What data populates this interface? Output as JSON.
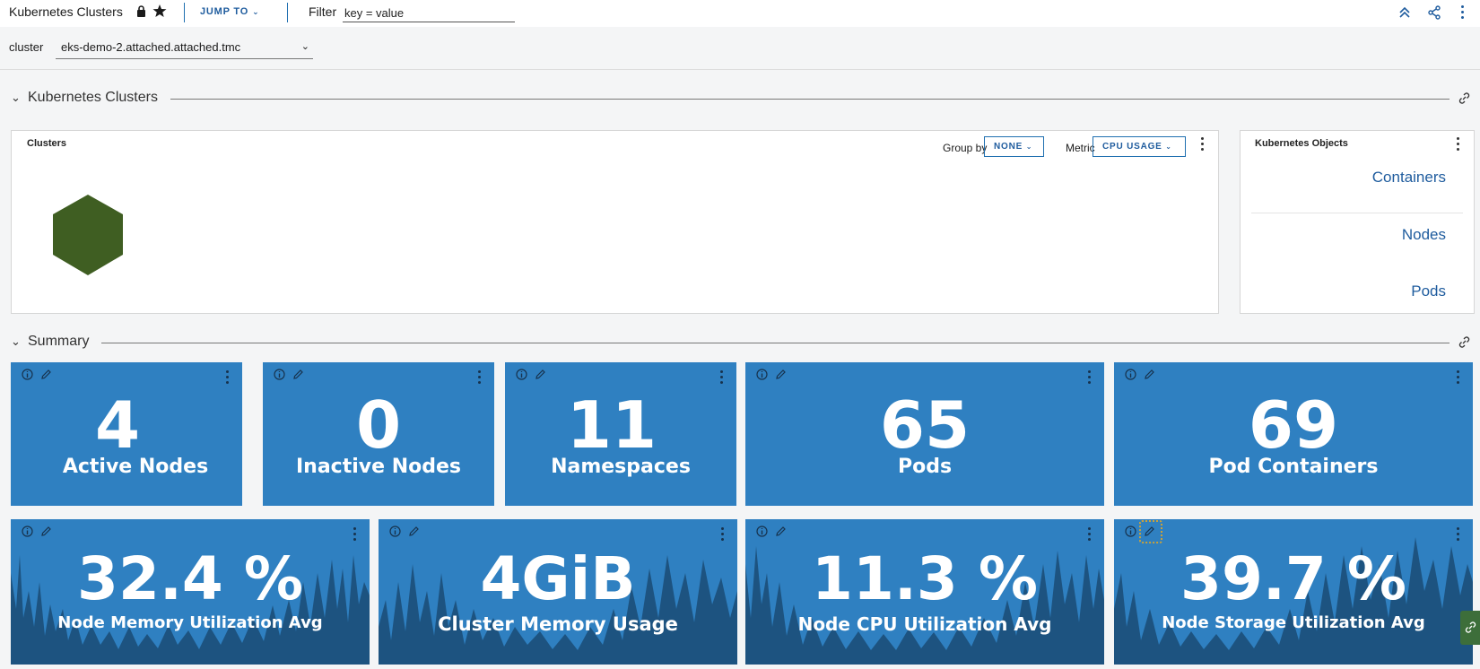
{
  "header": {
    "title": "Kubernetes Clusters",
    "jump_to": "JUMP TO",
    "filter_label": "Filter",
    "filter_value": "key = value"
  },
  "cluster_filter": {
    "label": "cluster",
    "selected": "eks-demo-2.attached.attached.tmc"
  },
  "sections": {
    "clusters_section": "Kubernetes Clusters",
    "summary_section": "Summary"
  },
  "clusters_panel": {
    "title": "Clusters",
    "group_by_label": "Group by",
    "group_by_value": "NONE",
    "metric_label": "Metric",
    "metric_value": "CPU USAGE",
    "hex_color": "#3f5e22"
  },
  "objects_panel": {
    "title": "Kubernetes Objects",
    "links": [
      "Containers",
      "Nodes",
      "Pods"
    ]
  },
  "tiles_row1": [
    {
      "value": "4",
      "label": "Active Nodes"
    },
    {
      "value": "0",
      "label": "Inactive Nodes"
    },
    {
      "value": "11",
      "label": "Namespaces"
    },
    {
      "value": "65",
      "label": "Pods"
    },
    {
      "value": "69",
      "label": "Pod Containers"
    }
  ],
  "tiles_row2": [
    {
      "value": "32.4 %",
      "label": "Node Memory Utilization Avg"
    },
    {
      "value": "4GiB",
      "label": "Cluster Memory Usage"
    },
    {
      "value": "11.3 %",
      "label": "Node CPU Utilization Avg"
    },
    {
      "value": "39.7 %",
      "label": "Node Storage Utilization Avg"
    }
  ],
  "colors": {
    "tile_bg": "#2f80c1",
    "tile_spark": "#1d5380",
    "accent": "#1f5c9e"
  }
}
